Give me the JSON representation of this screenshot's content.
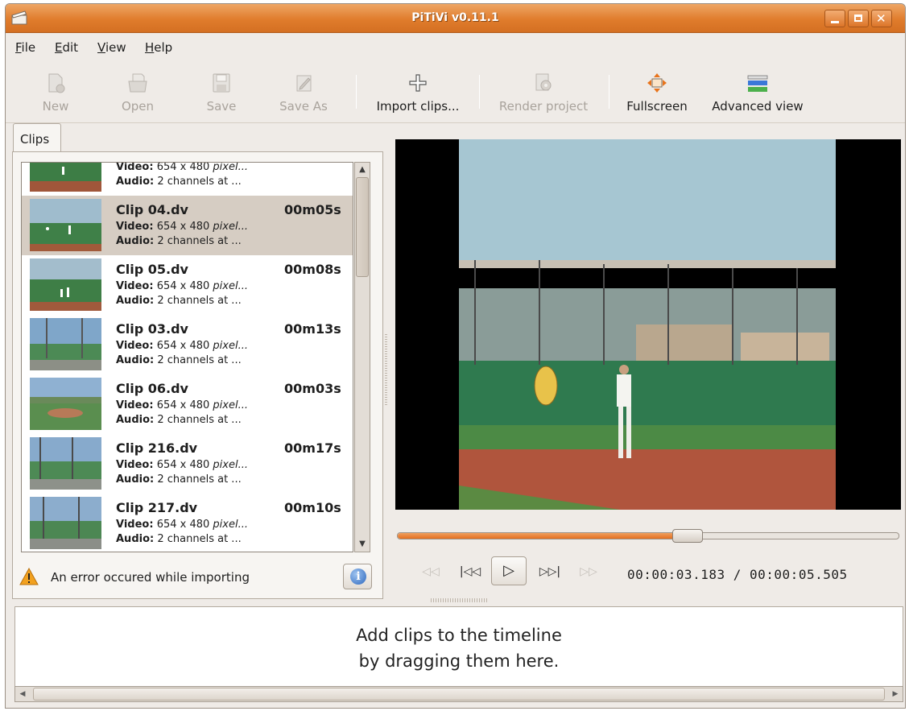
{
  "window": {
    "title": "PiTiVi v0.11.1"
  },
  "menu": [
    {
      "mnemonic": "F",
      "rest": "ile"
    },
    {
      "mnemonic": "E",
      "rest": "dit"
    },
    {
      "mnemonic": "V",
      "rest": "iew"
    },
    {
      "mnemonic": "H",
      "rest": "elp"
    }
  ],
  "toolbar": {
    "new": "New",
    "open": "Open",
    "save": "Save",
    "save_as": "Save As",
    "import": "Import clips...",
    "render": "Render project",
    "fullscreen": "Fullscreen",
    "advanced": "Advanced view"
  },
  "clips_tab": "Clips",
  "clips": [
    {
      "name": "",
      "duration": "",
      "video_label": "Video:",
      "video": "654 x 480",
      "video_unit": "pixel...",
      "audio_label": "Audio:",
      "audio": "2 channels at ...",
      "selected": false
    },
    {
      "name": "Clip 04.dv",
      "duration": "00m05s",
      "video_label": "Video:",
      "video": "654 x 480",
      "video_unit": "pixel...",
      "audio_label": "Audio:",
      "audio": "2 channels at ...",
      "selected": true
    },
    {
      "name": "Clip 05.dv",
      "duration": "00m08s",
      "video_label": "Video:",
      "video": "654 x 480",
      "video_unit": "pixel...",
      "audio_label": "Audio:",
      "audio": "2 channels at ...",
      "selected": false
    },
    {
      "name": "Clip 03.dv",
      "duration": "00m13s",
      "video_label": "Video:",
      "video": "654 x 480",
      "video_unit": "pixel...",
      "audio_label": "Audio:",
      "audio": "2 channels at ...",
      "selected": false
    },
    {
      "name": "Clip 06.dv",
      "duration": "00m03s",
      "video_label": "Video:",
      "video": "654 x 480",
      "video_unit": "pixel...",
      "audio_label": "Audio:",
      "audio": "2 channels at ...",
      "selected": false
    },
    {
      "name": "Clip 216.dv",
      "duration": "00m17s",
      "video_label": "Video:",
      "video": "654 x 480",
      "video_unit": "pixel...",
      "audio_label": "Audio:",
      "audio": "2 channels at ...",
      "selected": false
    },
    {
      "name": "Clip 217.dv",
      "duration": "00m10s",
      "video_label": "Video:",
      "video": "654 x 480",
      "video_unit": "pixel...",
      "audio_label": "Audio:",
      "audio": "2 channels at ...",
      "selected": false
    }
  ],
  "error_message": "An error occured while importing",
  "playback": {
    "position_fraction": 0.578,
    "current_time": "00:00:03.183",
    "separator": "/",
    "total_time": "00:00:05.505"
  },
  "timeline": {
    "hint_line1": "Add clips to the timeline",
    "hint_line2": "by dragging them here."
  },
  "colors": {
    "titlebar": "#e07c2c",
    "accent": "#e36e1e",
    "selection": "#d6cdc3"
  }
}
